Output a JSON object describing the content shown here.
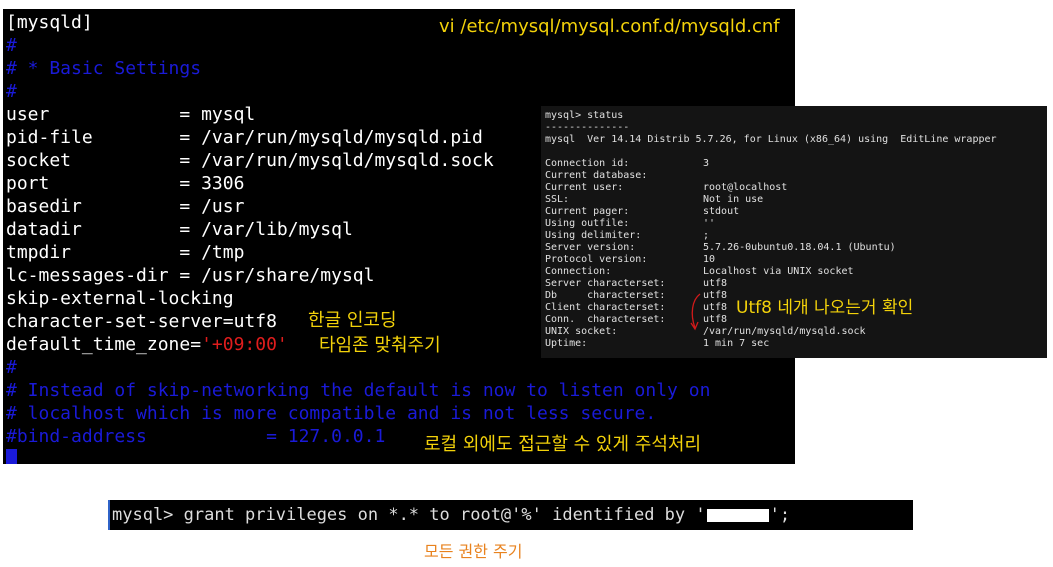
{
  "vi": {
    "file_path": "vi /etc/mysql/mysql.conf.d/mysqld.cnf",
    "lines": {
      "section": "[mysqld]",
      "hash1": "#",
      "comment_basic": "# * Basic Settings",
      "hash2": "#",
      "user": "user            = mysql",
      "pid_file": "pid-file        = /var/run/mysqld/mysqld.pid",
      "socket": "socket          = /var/run/mysqld/mysqld.sock",
      "port": "port            = 3306",
      "basedir": "basedir         = /usr",
      "datadir": "datadir         = /var/lib/mysql",
      "tmpdir": "tmpdir          = /tmp",
      "lc_messages": "lc-messages-dir = /usr/share/mysql",
      "skip_external": "skip-external-locking",
      "charset": "character-set-server=utf8",
      "timezone_key": "default_time_zone=",
      "timezone_val": "'+09:00'",
      "hash3": "#",
      "comment_networking_1": "# Instead of skip-networking the default is now to listen only on",
      "comment_networking_2": "# localhost which is more compatible and is not less secure.",
      "bind_address": "#bind-address           = 127.0.0.1"
    },
    "annotations": {
      "encoding": "한글 인코딩",
      "timezone": "타임존 맞춰주기",
      "bind": "로컬 외에도 접근할 수 있게 주석처리"
    }
  },
  "status_panel": {
    "prompt": "mysql> status",
    "divider": "--------------",
    "version_line": "mysql  Ver 14.14 Distrib 5.7.26, for Linux (x86_64) using  EditLine wrapper",
    "rows": [
      {
        "key": "Connection id:",
        "value": "3"
      },
      {
        "key": "Current database:",
        "value": ""
      },
      {
        "key": "Current user:",
        "value": "root@localhost"
      },
      {
        "key": "SSL:",
        "value": "Not in use"
      },
      {
        "key": "Current pager:",
        "value": "stdout"
      },
      {
        "key": "Using outfile:",
        "value": "''"
      },
      {
        "key": "Using delimiter:",
        "value": ";"
      },
      {
        "key": "Server version:",
        "value": "5.7.26-0ubuntu0.18.04.1 (Ubuntu)"
      },
      {
        "key": "Protocol version:",
        "value": "10"
      },
      {
        "key": "Connection:",
        "value": "Localhost via UNIX socket"
      },
      {
        "key": "Server characterset:",
        "value": "utf8"
      },
      {
        "key": "Db     characterset:",
        "value": "utf8"
      },
      {
        "key": "Client characterset:",
        "value": "utf8"
      },
      {
        "key": "Conn.  characterset:",
        "value": "utf8"
      },
      {
        "key": "UNIX socket:",
        "value": "/var/run/mysqld/mysqld.sock"
      },
      {
        "key": "Uptime:",
        "value": "1 min 7 sec"
      }
    ],
    "annotation": "Utf8 네개 나오는거 확인",
    "annotation_color": "#f3d20a",
    "arrow_color": "#d11a1a"
  },
  "grant": {
    "command_prefix": "mysql> grant privileges on *.* to root@'%' identified by '",
    "command_suffix": "';",
    "caption": "모든 권한 주기",
    "caption_color": "#e8821e"
  },
  "colors": {
    "terminal_bg": "#000000",
    "comment_blue": "#1a1ad8",
    "string_red": "#e01d1d",
    "annotation_yellow": "#f3d20a"
  }
}
